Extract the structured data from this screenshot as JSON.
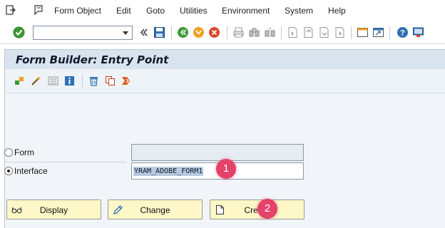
{
  "menubar": {
    "items": [
      "Form Object",
      "Edit",
      "Goto",
      "Utilities",
      "Environment",
      "System",
      "Help"
    ]
  },
  "toolbar": {
    "command_field_value": ""
  },
  "title": "Form Builder: Entry Point",
  "form_options": [
    {
      "label": "Form",
      "value": "",
      "selected": false,
      "editable": false
    },
    {
      "label": "Interface",
      "value": "YRAM_ADOBE_FORM1",
      "selected": true,
      "editable": true
    }
  ],
  "buttons": [
    "Display",
    "Change",
    "Create"
  ],
  "annotations": [
    "1",
    "2"
  ],
  "colors": {
    "title_bar": "#d9e3ee",
    "main_bg": "#f1f5f9",
    "button_bg": "#fef8c8",
    "marker": "#e4426a"
  }
}
